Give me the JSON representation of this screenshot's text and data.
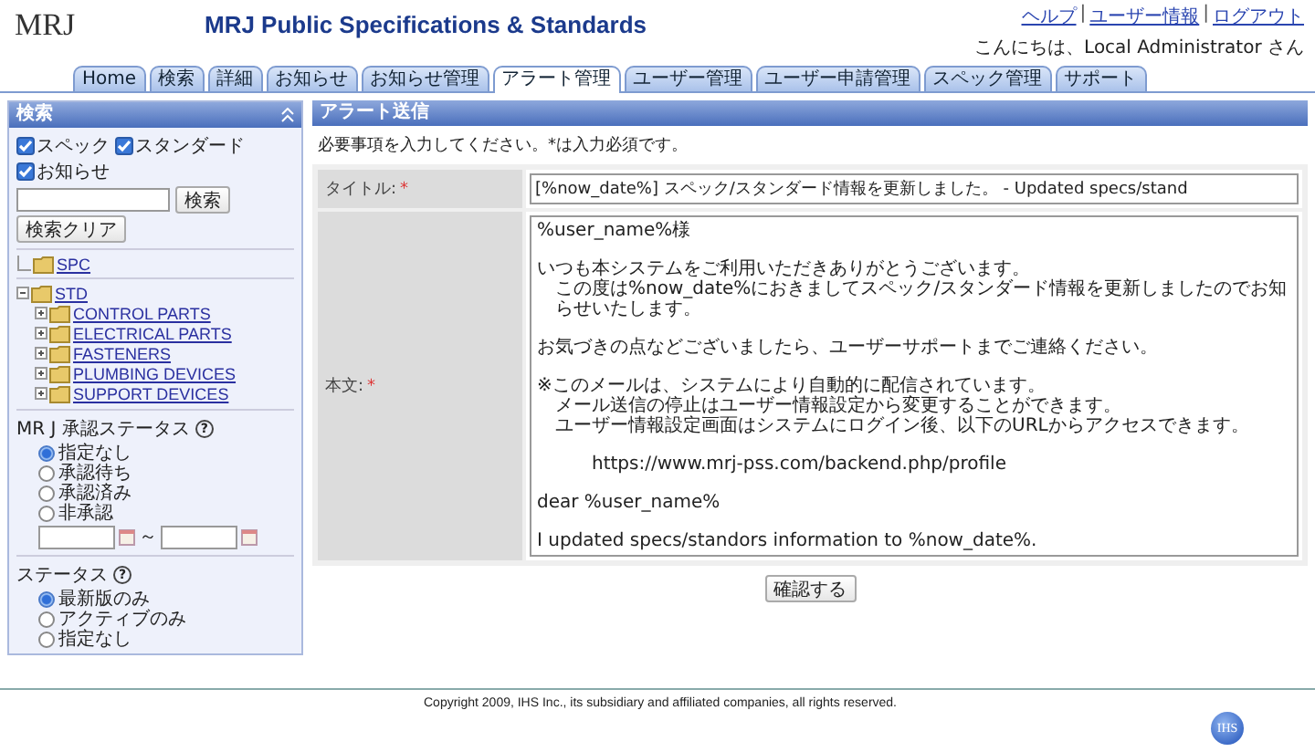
{
  "header": {
    "logo": "MRJ",
    "title": "MRJ Public Specifications & Standards",
    "links": [
      "ヘルプ",
      "ユーザー情報",
      "ログアウト"
    ],
    "link_separator": "|",
    "greeting": "こんにちは、Local Administrator さん"
  },
  "tabs": [
    {
      "label": "Home",
      "selected": false
    },
    {
      "label": "検索",
      "selected": false
    },
    {
      "label": "詳細",
      "selected": false
    },
    {
      "label": "お知らせ",
      "selected": false
    },
    {
      "label": "お知らせ管理",
      "selected": false
    },
    {
      "label": "アラート管理",
      "selected": true
    },
    {
      "label": "ユーザー管理",
      "selected": false
    },
    {
      "label": "ユーザー申請管理",
      "selected": false
    },
    {
      "label": "スペック管理",
      "selected": false
    },
    {
      "label": "サポート",
      "selected": false
    }
  ],
  "sidebar": {
    "title": "検索",
    "filters": [
      {
        "label": "スペック",
        "checked": true
      },
      {
        "label": "スタンダード",
        "checked": true
      },
      {
        "label": "お知らせ",
        "checked": true
      }
    ],
    "search_button": "検索",
    "clear_button": "検索クリア",
    "tree": [
      {
        "label": "SPC",
        "kind": "leaf"
      },
      {
        "label": "STD",
        "kind": "branch",
        "expanded": true,
        "children": [
          {
            "label": "CONTROL PARTS",
            "kind": "branch",
            "expanded": false
          },
          {
            "label": "ELECTRICAL PARTS",
            "kind": "branch",
            "expanded": false
          },
          {
            "label": "FASTENERS",
            "kind": "branch",
            "expanded": false
          },
          {
            "label": "PLUMBING DEVICES",
            "kind": "branch",
            "expanded": false
          },
          {
            "label": "SUPPORT DEVICES",
            "kind": "branch",
            "expanded": false
          }
        ]
      }
    ],
    "approval": {
      "label": "MR J 承認ステータス",
      "help": "?",
      "options": [
        {
          "label": "指定なし",
          "selected": true
        },
        {
          "label": "承認待ち",
          "selected": false
        },
        {
          "label": "承認済み",
          "selected": false
        },
        {
          "label": "非承認",
          "selected": false
        }
      ],
      "range_separator": "～"
    },
    "status": {
      "label": "ステータス",
      "help": "?",
      "options": [
        {
          "label": "最新版のみ",
          "selected": true
        },
        {
          "label": "アクティブのみ",
          "selected": false
        },
        {
          "label": "指定なし",
          "selected": false
        }
      ]
    }
  },
  "panel": {
    "title": "アラート送信",
    "note": "必要事項を入力してください。*は入力必須です。",
    "fields": [
      {
        "label": "タイトル:",
        "required": "*",
        "kind": "line",
        "value": "[%now_date%] スペック/スタンダード情報を更新しました。 - Updated specs/stand"
      },
      {
        "label": "本文:",
        "required": "*",
        "kind": "area",
        "paragraphs": [
          [
            "%user_name%様"
          ],
          [
            "いつも本システムをご利用いただきありがとうございます。",
            "この度は%now_date%におきましてスペック/スタンダード情報を更新しましたのでお知らせいたします。"
          ],
          [
            "お気づきの点などございましたら、ユーザーサポートまでご連絡ください。"
          ],
          [
            "※このメールは、システムにより自動的に配信されています。",
            "メール送信の停止はユーザー情報設定から変更することができます。",
            "ユーザー情報設定画面はシステムにログイン後、以下のURLからアクセスできます。"
          ],
          [
            "https://www.mrj-pss.com/backend.php/profile"
          ],
          [
            "dear %user_name%"
          ],
          [
            "I updated specs/standors information to %now_date%."
          ]
        ]
      }
    ],
    "confirm_button": "確認する"
  },
  "footer": {
    "copyright": "Copyright 2009, IHS Inc., its subsidiary and affiliated companies, all rights reserved.",
    "logo": "IHS"
  }
}
